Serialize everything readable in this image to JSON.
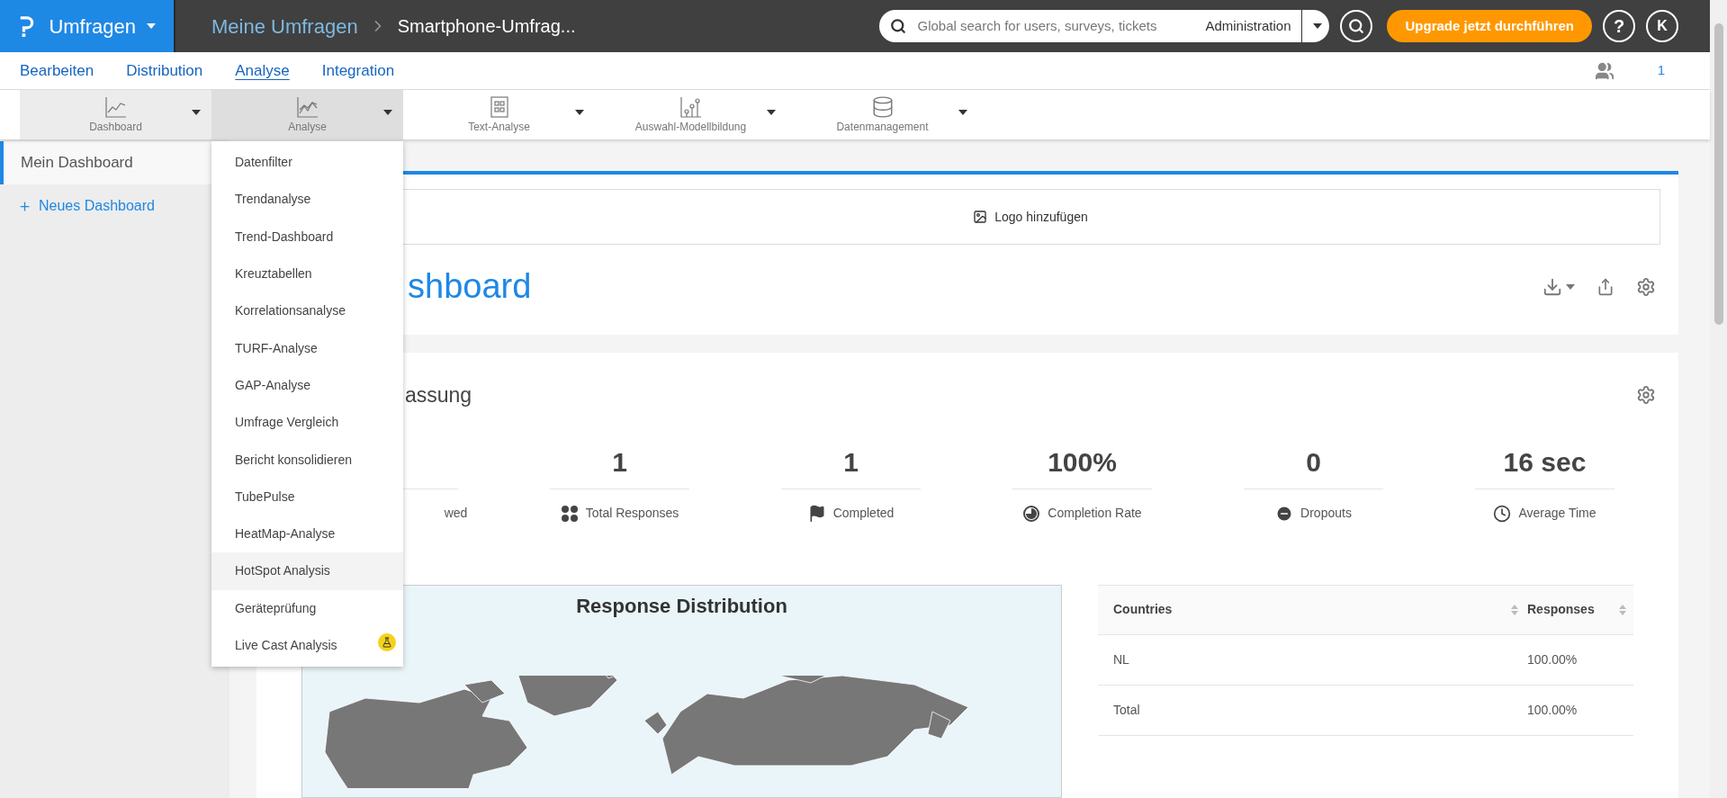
{
  "header": {
    "module": "Umfragen",
    "breadcrumb": "Meine Umfragen",
    "current": "Smartphone-Umfrag...",
    "search": {
      "placeholder": "Global search for users, surveys, tickets",
      "scope": "Administration"
    },
    "upgrade_button": "Upgrade jetzt durchführen",
    "help": "?",
    "avatar": "K"
  },
  "nav_tabs": [
    {
      "label": "Bearbeiten",
      "selected": false
    },
    {
      "label": "Distribution",
      "selected": false
    },
    {
      "label": "Analyse",
      "selected": true
    },
    {
      "label": "Integration",
      "selected": false
    }
  ],
  "members": "1",
  "toolbar": [
    {
      "label": "Dashboard",
      "kind": "line",
      "selected": false
    },
    {
      "label": "Analyse",
      "kind": "trend",
      "selected": true
    },
    {
      "label": "Text-Analyse",
      "kind": "document",
      "selected": false
    },
    {
      "label": "Auswahl-Modellbildung",
      "kind": "scatter",
      "selected": false
    },
    {
      "label": "Datenmanagement",
      "kind": "database",
      "selected": false
    }
  ],
  "sidebar": {
    "items": [
      {
        "label": "Mein Dashboard",
        "selected": true
      }
    ],
    "new_dashboard": "Neues Dashboard"
  },
  "menu": [
    {
      "label": "Datenfilter",
      "selected": false,
      "beta": false
    },
    {
      "label": "Trendanalyse",
      "selected": false,
      "beta": false
    },
    {
      "label": "Trend-Dashboard",
      "selected": false,
      "beta": false
    },
    {
      "label": "Kreuztabellen",
      "selected": false,
      "beta": false
    },
    {
      "label": "Korrelationsanalyse",
      "selected": false,
      "beta": false
    },
    {
      "label": "TURF-Analyse",
      "selected": false,
      "beta": false
    },
    {
      "label": "GAP-Analyse",
      "selected": false,
      "beta": false
    },
    {
      "label": "Umfrage Vergleich",
      "selected": false,
      "beta": false
    },
    {
      "label": "Bericht konsolidieren",
      "selected": false,
      "beta": false
    },
    {
      "label": "TubePulse",
      "selected": false,
      "beta": false
    },
    {
      "label": "HeatMap-Analyse",
      "selected": false,
      "beta": false
    },
    {
      "label": "HotSpot Analysis",
      "selected": true,
      "beta": false
    },
    {
      "label": "Geräteprüfung",
      "selected": false,
      "beta": false
    },
    {
      "label": "Live Cast Analysis",
      "selected": false,
      "beta": true
    }
  ],
  "dashboard": {
    "logo_button": "Logo hinzufügen",
    "title": "shboard"
  },
  "summary": {
    "title": "assung",
    "stats": [
      {
        "kind": "viewed",
        "label": "wed"
      },
      {
        "kind": "responses",
        "value": "1",
        "label": "Total Responses"
      },
      {
        "kind": "completed",
        "value": "1",
        "label": "Completed"
      },
      {
        "kind": "rate",
        "value": "100%",
        "label": "Completion Rate"
      },
      {
        "kind": "dropouts",
        "value": "0",
        "label": "Dropouts"
      },
      {
        "kind": "time",
        "value": "16 sec",
        "label": "Average Time"
      }
    ]
  },
  "map": {
    "title": "Response Distribution"
  },
  "table": {
    "columns": [
      "Countries",
      "Responses"
    ],
    "rows": [
      [
        "NL",
        "100.00%"
      ],
      [
        "Total",
        "100.00%"
      ]
    ]
  }
}
